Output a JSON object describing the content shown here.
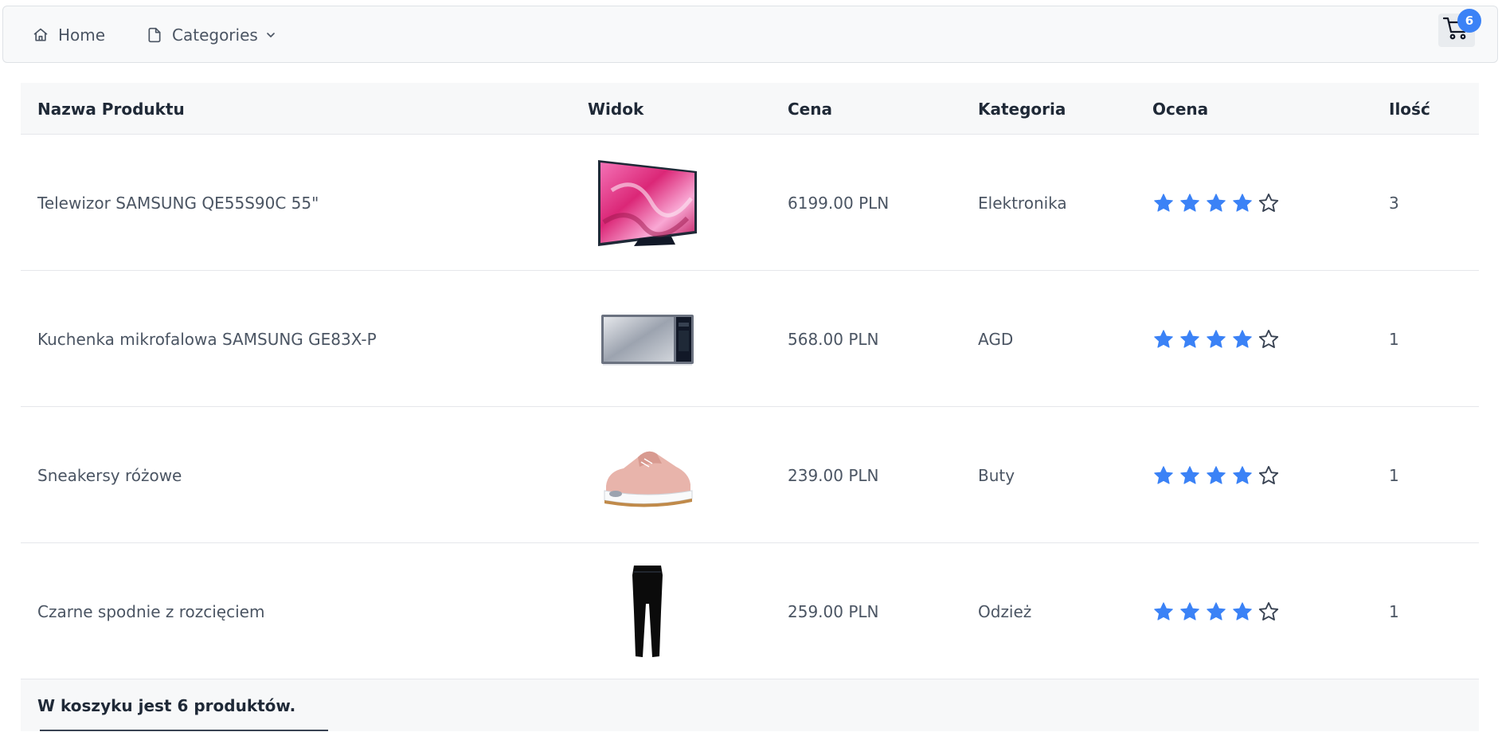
{
  "nav": {
    "home_label": "Home",
    "home_icon": "home-icon",
    "categories_label": "Categories",
    "categories_icon": "file-icon",
    "cart_icon": "cart-icon",
    "cart_count": "6"
  },
  "colors": {
    "accent": "#3b82f6",
    "navbar_bg": "#f8f9fa"
  },
  "table": {
    "headers": [
      "Nazwa Produktu",
      "Widok",
      "Cena",
      "Kategoria",
      "Ocena",
      "Ilość"
    ],
    "rows": [
      {
        "name": "Telewizor SAMSUNG QE55S90C 55\"",
        "image": "tv-image",
        "price": "6199.00 PLN",
        "category": "Elektronika",
        "rating": 4,
        "rating_max": 5,
        "qty": "3"
      },
      {
        "name": "Kuchenka mikrofalowa SAMSUNG GE83X-P",
        "image": "microwave-image",
        "price": "568.00 PLN",
        "category": "AGD",
        "rating": 4,
        "rating_max": 5,
        "qty": "1"
      },
      {
        "name": "Sneakersy różowe",
        "image": "sneaker-image",
        "price": "239.00 PLN",
        "category": "Buty",
        "rating": 4,
        "rating_max": 5,
        "qty": "1"
      },
      {
        "name": "Czarne spodnie z rozcięciem",
        "image": "pants-image",
        "price": "259.00 PLN",
        "category": "Odzież",
        "rating": 4,
        "rating_max": 5,
        "qty": "1"
      }
    ],
    "footer": "W koszyku jest 6 produktów."
  }
}
